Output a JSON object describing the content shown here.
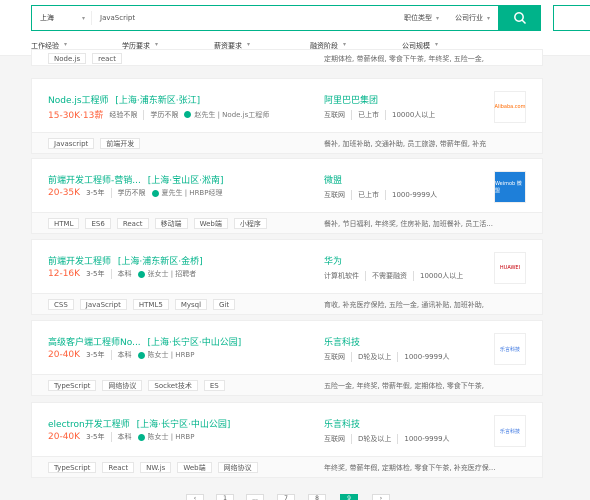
{
  "search": {
    "city": "上海",
    "keyword": "JavaScript",
    "filters": [
      "职位类型",
      "公司行业"
    ]
  },
  "filters": [
    "工作经验",
    "学历要求",
    "薪资要求",
    "融资阶段",
    "公司规模"
  ],
  "top_card": {
    "tags": [
      "Node.js",
      "react"
    ],
    "benefits": "定期体检, 带薪休假, 零食下午茶, 年终奖, 五险一金,"
  },
  "jobs": [
    {
      "title": "Node.js工程师",
      "location": "[上海·浦东新区·张江]",
      "salary": "15-30K·13薪",
      "exp": "经验不限",
      "edu": "学历不限",
      "hr": "赵先生 | Node.js工程师",
      "company": "阿里巴巴集团",
      "industry": "互联网",
      "stage": "已上市",
      "size": "10000人以上",
      "tags": [
        "Javascript",
        "前端开发"
      ],
      "benefits": "餐补, 加班补助, 交通补助, 员工旅游, 带薪年假, 补充",
      "logo": "Alibaba.com",
      "logo_color": "#ff6a00"
    },
    {
      "title": "前端开发工程师-营销...",
      "location": "[上海·宝山区·淞南]",
      "salary": "20-35K",
      "exp": "3-5年",
      "edu": "学历不限",
      "hr": "夏先生 | HRBP经理",
      "company": "微盟",
      "industry": "互联网",
      "stage": "已上市",
      "size": "1000-9999人",
      "tags": [
        "HTML",
        "ES6",
        "React",
        "移动端",
        "Web端",
        "小程序"
      ],
      "benefits": "餐补, 节日福利, 年终奖, 住房补贴, 加班餐补, 员工活...",
      "logo": "Weimob 微盟",
      "logo_color": "#1e7fd9"
    },
    {
      "title": "前端开发工程师",
      "location": "[上海·浦东新区·金桥]",
      "salary": "12-16K",
      "exp": "3-5年",
      "edu": "本科",
      "hr": "张女士 | 招聘者",
      "company": "华为",
      "industry": "计算机软件",
      "stage": "不需要融资",
      "size": "10000人以上",
      "tags": [
        "CSS",
        "JavaScript",
        "HTML5",
        "Mysql",
        "Git"
      ],
      "benefits": "育收, 补充医疗保险, 五险一金, 通讯补贴, 加班补助,",
      "logo": "HUAWEI",
      "logo_color": "#c7000b"
    },
    {
      "title": "高级客户端工程师No...",
      "location": "[上海·长宁区·中山公园]",
      "salary": "20-40K",
      "exp": "3-5年",
      "edu": "本科",
      "hr": "陈女士 | HRBP",
      "company": "乐言科技",
      "industry": "互联网",
      "stage": "D轮及以上",
      "size": "1000-9999人",
      "tags": [
        "TypeScript",
        "网络协议",
        "Socket技术",
        "ES"
      ],
      "benefits": "五险一金, 年终奖, 带薪年假, 定期体检, 零食下午茶,",
      "logo": "乐言科技",
      "logo_color": "#2d6cdf"
    },
    {
      "title": "electron开发工程师",
      "location": "[上海·长宁区·中山公园]",
      "salary": "20-40K",
      "exp": "3-5年",
      "edu": "本科",
      "hr": "陈女士 | HRBP",
      "company": "乐言科技",
      "industry": "互联网",
      "stage": "D轮及以上",
      "size": "1000-9999人",
      "tags": [
        "TypeScript",
        "React",
        "NW.js",
        "Web端",
        "网络协议"
      ],
      "benefits": "年终奖, 带薪年假, 定期体检, 零食下午茶, 补充医疗保...",
      "logo": "乐言科技",
      "logo_color": "#2d6cdf"
    }
  ],
  "pager": [
    "‹",
    "1",
    "...",
    "7",
    "8",
    "9",
    "›"
  ]
}
